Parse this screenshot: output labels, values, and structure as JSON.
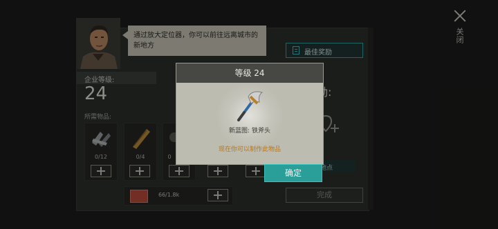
{
  "header": {
    "close_label": "关闭"
  },
  "npc": {
    "message": "通过放大定位器，你可以前往远离城市的新地方"
  },
  "best_reward_label": "最佳奖励",
  "company": {
    "level_label": "企业等级:",
    "level_value": "24",
    "required_items_label": "所需物品:"
  },
  "items": [
    {
      "icon": "crossbow-parts-icon",
      "count": "0/12"
    },
    {
      "icon": "wood-plank-icon",
      "count": "0/4"
    },
    {
      "icon": "hidden-item-icon",
      "count": "0"
    }
  ],
  "bottom_item": {
    "icon": "red-card-icon",
    "amount": "66/1.8k"
  },
  "reward": {
    "label": "励:",
    "find_label": "新地点"
  },
  "complete_label": "完成",
  "modal": {
    "title": "等级 24",
    "subtitle": "新蓝图: 铁斧头",
    "craft_notice": "现在你可以制作此物品",
    "confirm_label": "确定"
  },
  "colors": {
    "accent": "#2a9f9a",
    "notice": "#b27822"
  }
}
